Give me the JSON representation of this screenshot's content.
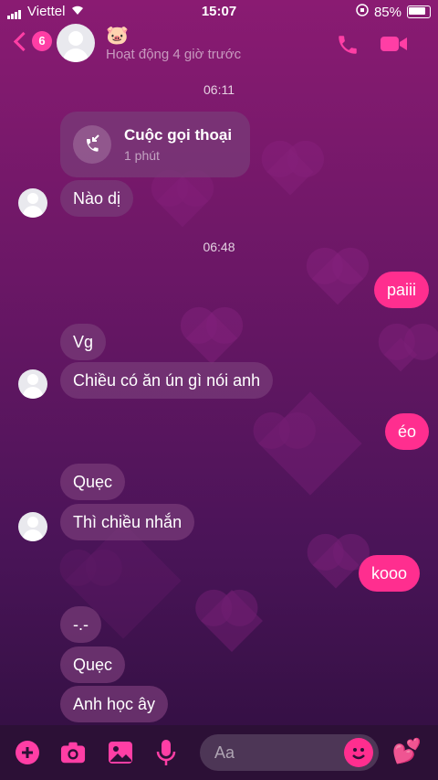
{
  "status": {
    "carrier": "Viettel",
    "time": "15:07",
    "battery": "85%"
  },
  "header": {
    "back_count": "6",
    "name_emoji": "🐷",
    "activity": "Hoạt động 4 giờ trước"
  },
  "chat": {
    "timestamps": [
      "06:11",
      "06:48"
    ],
    "call": {
      "title": "Cuộc gọi thoại",
      "duration": "1 phút"
    },
    "messages": [
      {
        "text": "Nào dị"
      },
      {
        "text": "paiii"
      },
      {
        "text": "Vg"
      },
      {
        "text": "Chiều có ăn ún gì nói anh"
      },
      {
        "text": "éo"
      },
      {
        "text": "Quẹc"
      },
      {
        "text": "Thì chiều nhắn"
      },
      {
        "text": "kooo"
      },
      {
        "text": "-.-"
      },
      {
        "text": "Quẹc"
      },
      {
        "text": "Anh học ây"
      }
    ]
  },
  "composer": {
    "placeholder": "Aa",
    "like_emoji": "💕"
  },
  "colors": {
    "accent": "#ff3ea5",
    "out_bubble": "#ff2e8f"
  }
}
